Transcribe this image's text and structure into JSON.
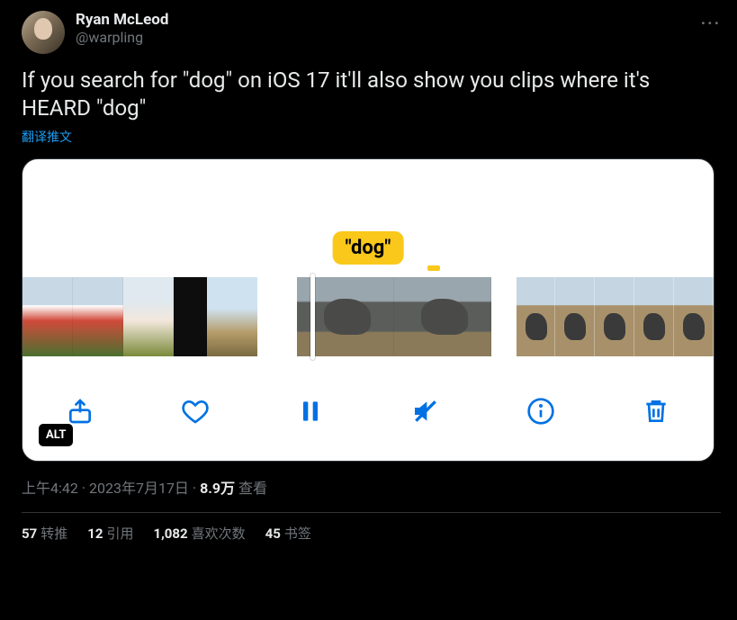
{
  "user": {
    "display_name": "Ryan McLeod",
    "handle": "@warpling"
  },
  "body_text": "If you search for \"dog\" on iOS 17 it'll also show you clips where it's HEARD \"dog\"",
  "translate_label": "翻译推文",
  "media": {
    "bubble_text": "\"dog\"",
    "alt_badge": "ALT"
  },
  "meta": {
    "time": "上午4:42",
    "date": "2023年7月17日",
    "views_number": "8.9万",
    "views_label": "查看"
  },
  "stats": {
    "retweets_n": "57",
    "retweets_label": "转推",
    "quotes_n": "12",
    "quotes_label": "引用",
    "likes_n": "1,082",
    "likes_label": "喜欢次数",
    "bookmarks_n": "45",
    "bookmarks_label": "书签"
  }
}
